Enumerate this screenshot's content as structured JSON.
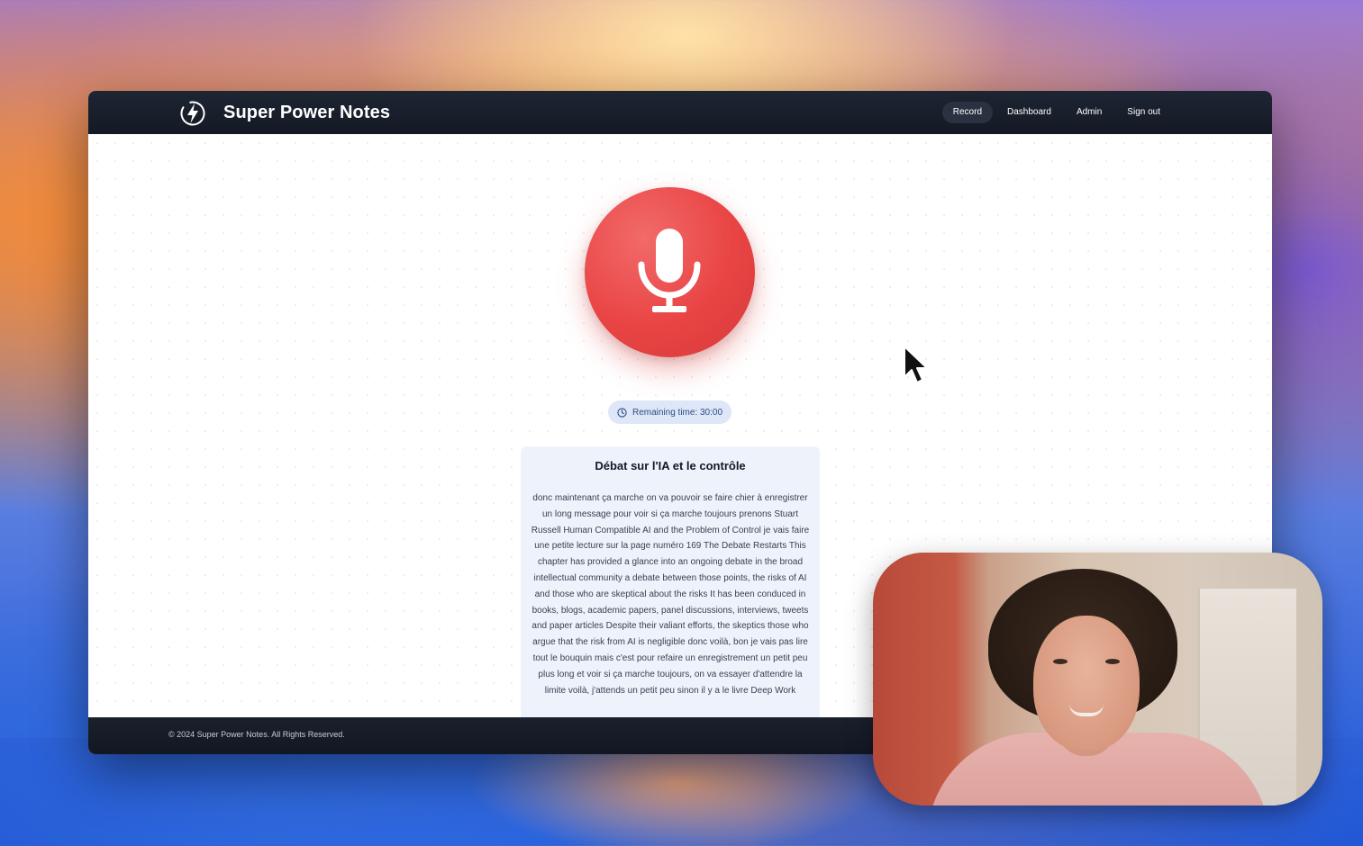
{
  "app": {
    "brand": "Super Power Notes"
  },
  "nav": {
    "items": [
      {
        "label": "Record",
        "active": true
      },
      {
        "label": "Dashboard",
        "active": false
      },
      {
        "label": "Admin",
        "active": false
      },
      {
        "label": "Sign out",
        "active": false
      }
    ]
  },
  "recorder": {
    "icon": "microphone-icon",
    "button_color": "#e94444",
    "timer_label": "Remaining time: 30:00",
    "timer_icon": "clock-icon"
  },
  "transcript": {
    "title": "Débat sur l'IA et le contrôle",
    "body": "donc maintenant ça marche on va pouvoir se faire chier à enregistrer un long message pour voir si ça marche toujours prenons Stuart Russell Human Compatible AI and the Problem of Control je vais faire une petite lecture sur la page numéro 169 The Debate Restarts This chapter has provided a glance into an ongoing debate in the broad intellectual community a debate between those points, the risks of AI and those who are skeptical about the risks It has been conduced in books, blogs, academic papers, panel discussions, interviews, tweets and paper articles Despite their valiant efforts, the skeptics those who argue that the risk from AI is negligible donc voilà, bon je vais pas lire tout le bouquin mais c'est pour refaire un enregistrement un petit peu plus long et voir si ça marche toujours, on va essayer d'attendre la limite voilà, j'attends un petit peu sinon il y a le livre Deep Work"
  },
  "footer": {
    "copyright": "© 2024 Super Power Notes. All Rights Reserved."
  },
  "colors": {
    "navbar": "#1a202c",
    "accent_red": "#e94444",
    "timer_bg": "#dde7f7",
    "timer_text": "#2c4a86",
    "transcript_bg": "#eef3fb"
  }
}
